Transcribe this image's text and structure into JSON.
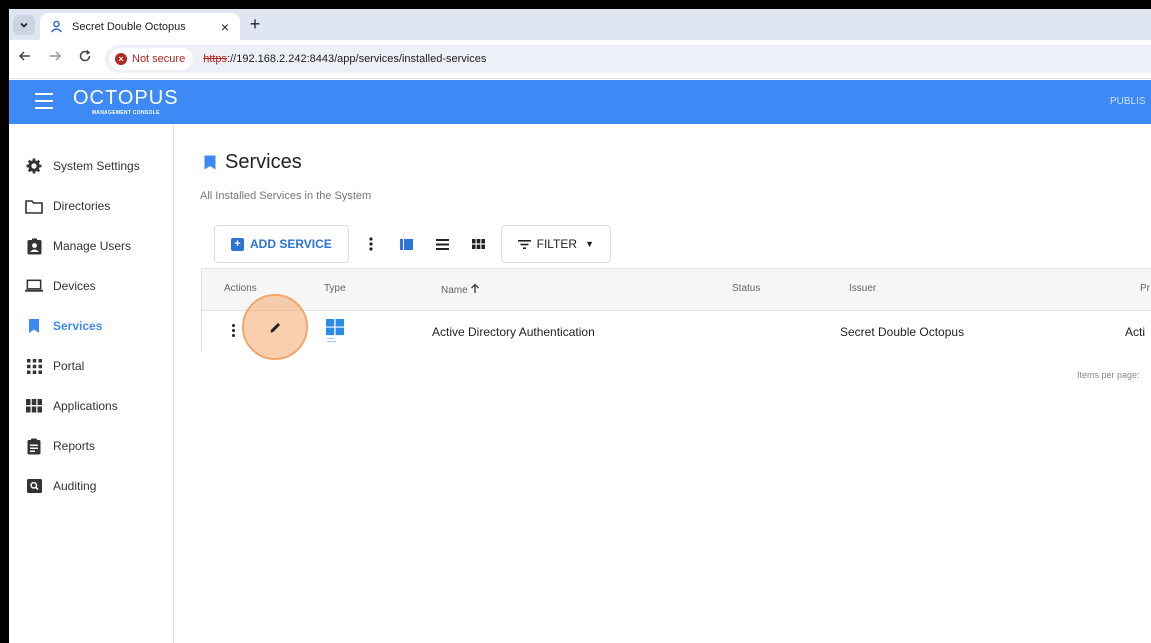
{
  "browser": {
    "tab_title": "Secret Double Octopus",
    "tab_close": "×",
    "new_tab": "+",
    "security_label": "Not secure",
    "url_scheme": "https",
    "url_rest": "://192.168.2.242:8443/app/services/installed-services"
  },
  "app": {
    "brand": "OCTOPUS",
    "brand_sub": "MANAGEMENT CONSOLE",
    "header_right": "PUBLIS"
  },
  "sidebar": {
    "items": [
      {
        "label": "System Settings",
        "icon": "gear-icon"
      },
      {
        "label": "Directories",
        "icon": "folder-icon"
      },
      {
        "label": "Manage Users",
        "icon": "user-badge-icon"
      },
      {
        "label": "Devices",
        "icon": "laptop-icon"
      },
      {
        "label": "Services",
        "icon": "bookmark-icon"
      },
      {
        "label": "Portal",
        "icon": "grid-icon"
      },
      {
        "label": "Applications",
        "icon": "apps-icon"
      },
      {
        "label": "Reports",
        "icon": "clipboard-icon"
      },
      {
        "label": "Auditing",
        "icon": "search-box-icon"
      }
    ],
    "active": "Services"
  },
  "main": {
    "title": "Services",
    "subtitle": "All Installed Services in the System",
    "add_service": "ADD SERVICE",
    "filter": "FILTER",
    "columns": {
      "actions": "Actions",
      "type": "Type",
      "name": "Name",
      "status": "Status",
      "issuer": "Issuer",
      "provider": "Pr"
    },
    "rows": [
      {
        "name": "Active Directory Authentication",
        "status": "",
        "issuer": "Secret Double Octopus",
        "provider": "Acti"
      }
    ],
    "items_per_page": "Items per page:"
  },
  "colors": {
    "accent": "#3d8af7",
    "highlight": "#f2a66a"
  }
}
